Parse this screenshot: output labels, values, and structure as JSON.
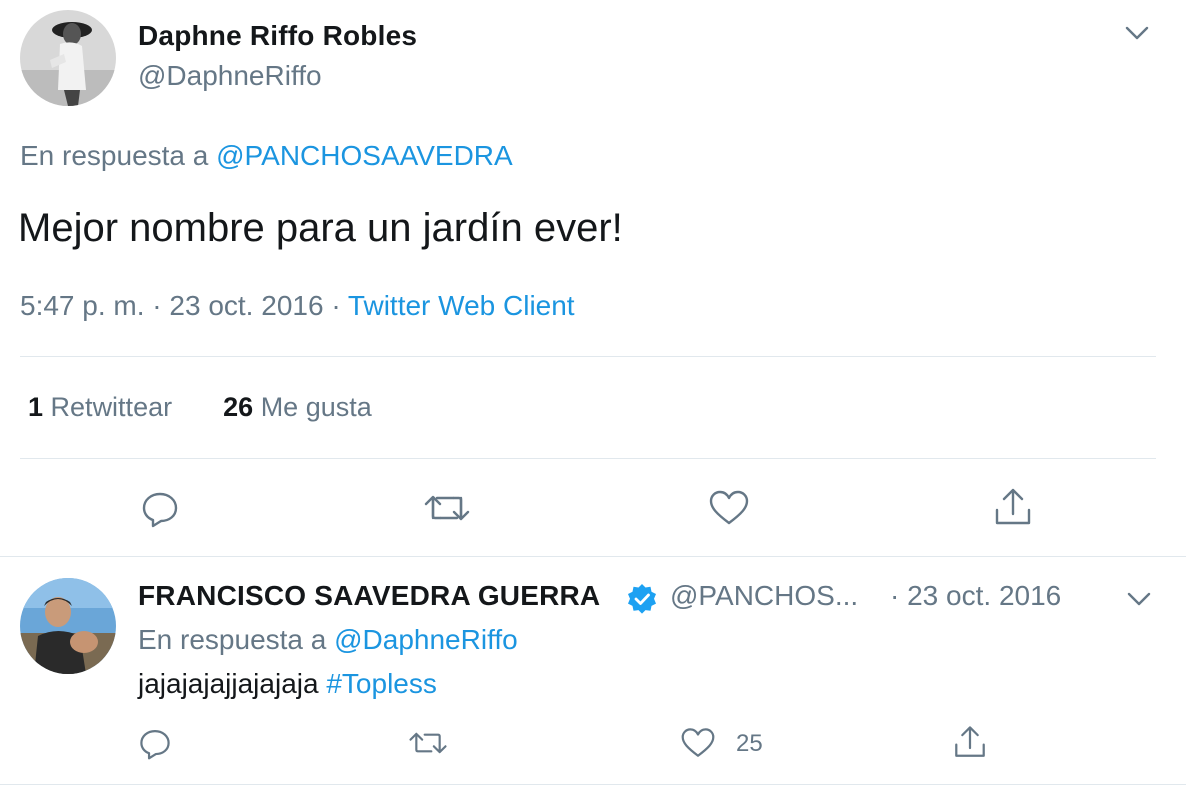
{
  "main_tweet": {
    "display_name": "Daphne Riffo Robles",
    "handle": "@DaphneRiffo",
    "reply_prefix": "En respuesta a",
    "reply_to": "@PANCHOSAAVEDRA",
    "text": "Mejor nombre para un jardín ever!",
    "time": "5:47 p. m.",
    "date": "23 oct. 2016",
    "separator": "·",
    "client": "Twitter Web Client",
    "retweets_count": "1",
    "retweets_label": "Retwittear",
    "likes_count": "26",
    "likes_label": "Me gusta",
    "icons": [
      "reply-icon",
      "retweet-icon",
      "like-icon",
      "share-icon",
      "chevron-down-icon"
    ]
  },
  "reply_tweet": {
    "display_name": "FRANCISCO SAAVEDRA GUERRA",
    "verified": true,
    "handle": "@PANCHOS...",
    "date": "· 23 oct. 2016",
    "reply_prefix": "En respuesta a",
    "reply_to": "@DaphneRiffo",
    "text_plain": "jajajajajjajajaja",
    "hashtag": "#Topless",
    "likes_count": "25",
    "icons": [
      "reply-icon",
      "retweet-icon",
      "like-icon",
      "share-icon",
      "chevron-down-icon"
    ]
  },
  "colors": {
    "text": "#14171a",
    "secondary": "#657786",
    "link": "#1b95e0",
    "divider": "#e1e8ed",
    "verified": "#1da1f2"
  }
}
